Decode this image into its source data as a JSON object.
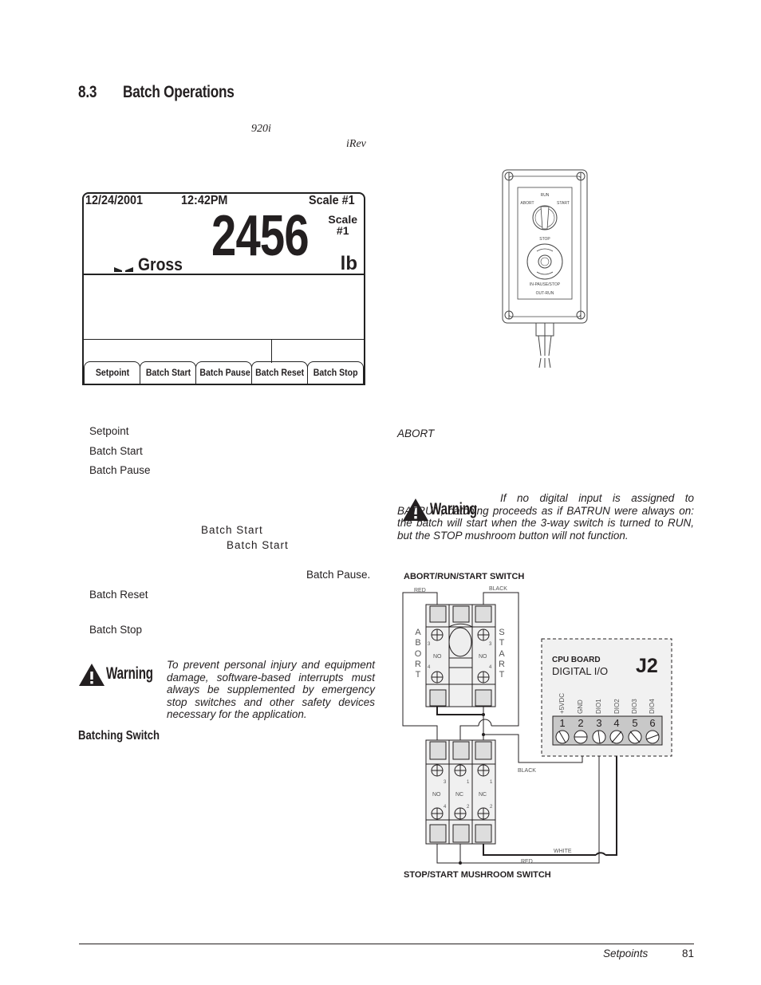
{
  "section": {
    "number": "8.3",
    "title": "Batch Operations"
  },
  "intro": {
    "model_name": "920i",
    "software_name": "iRev"
  },
  "lcd": {
    "date": "12/24/2001",
    "time": "12:42PM",
    "scale_label": "Scale #1",
    "weight_value": "2456",
    "scale_small_line1": "Scale",
    "scale_small_line2": "#1",
    "mode": "Gross",
    "unit": "lb",
    "softkeys": [
      "Setpoint",
      "Batch Start",
      "Batch Pause",
      "Batch Reset",
      "Batch Stop"
    ]
  },
  "definitions": {
    "setpoint": "Setpoint",
    "batch_start": "Batch Start",
    "batch_pause": "Batch Pause",
    "batch_start_ref1": "Batch Start",
    "batch_start_ref2": "Batch Start",
    "batch_pause_ref": "Batch Pause.",
    "batch_reset": "Batch Reset",
    "batch_stop": "Batch Stop"
  },
  "warning1": {
    "label": "Warning",
    "text": "To prevent personal injury and equipment damage, software-based interrupts must always be supplemented by emergency stop switches and other safety devices necessary for the application."
  },
  "subsection": {
    "title": "Batching Switch"
  },
  "right_column": {
    "abort_ref": "ABORT"
  },
  "switch_illustration": {
    "labels": [
      "RUN",
      "ABORT",
      "START",
      "STOP",
      "IN-PAUSE/STOP",
      "OUT-RUN"
    ]
  },
  "warning2": {
    "label": "Warning",
    "text": "If no digital input is assigned to BATRUN, batching proceeds as if BATRUN were always on: the batch will start when the 3-way switch is turned to RUN, but the STOP mushroom button will not function."
  },
  "wiring": {
    "top_title": "ABORT/RUN/START SWITCH",
    "bottom_title": "STOP/START MUSHROOM SWITCH",
    "wire_red": "RED",
    "wire_black": "BLACK",
    "wire_white": "WHITE",
    "abort_letters": [
      "A",
      "B",
      "O",
      "R",
      "T"
    ],
    "start_letters": [
      "S",
      "T",
      "A",
      "R",
      "T"
    ],
    "no_label": "NO",
    "nc_label": "NC",
    "cpu_board": "CPU BOARD",
    "digital_io": "DIGITAL I/O",
    "connector": "J2",
    "pins": [
      {
        "num": "1",
        "name": "+5VDC"
      },
      {
        "num": "2",
        "name": "GND"
      },
      {
        "num": "3",
        "name": "DIO1"
      },
      {
        "num": "4",
        "name": "DIO2"
      },
      {
        "num": "5",
        "name": "DIO3"
      },
      {
        "num": "6",
        "name": "DIO4"
      }
    ],
    "top_contacts": {
      "left_top": "3",
      "left_bottom": "4",
      "right_top": "3",
      "right_bottom": "4"
    },
    "bottom_contacts": [
      {
        "top": "3",
        "bottom": "4"
      },
      {
        "top": "1",
        "bottom": "2"
      },
      {
        "top": "1",
        "bottom": "2"
      }
    ]
  },
  "footer": {
    "chapter": "Setpoints",
    "page": "81"
  }
}
